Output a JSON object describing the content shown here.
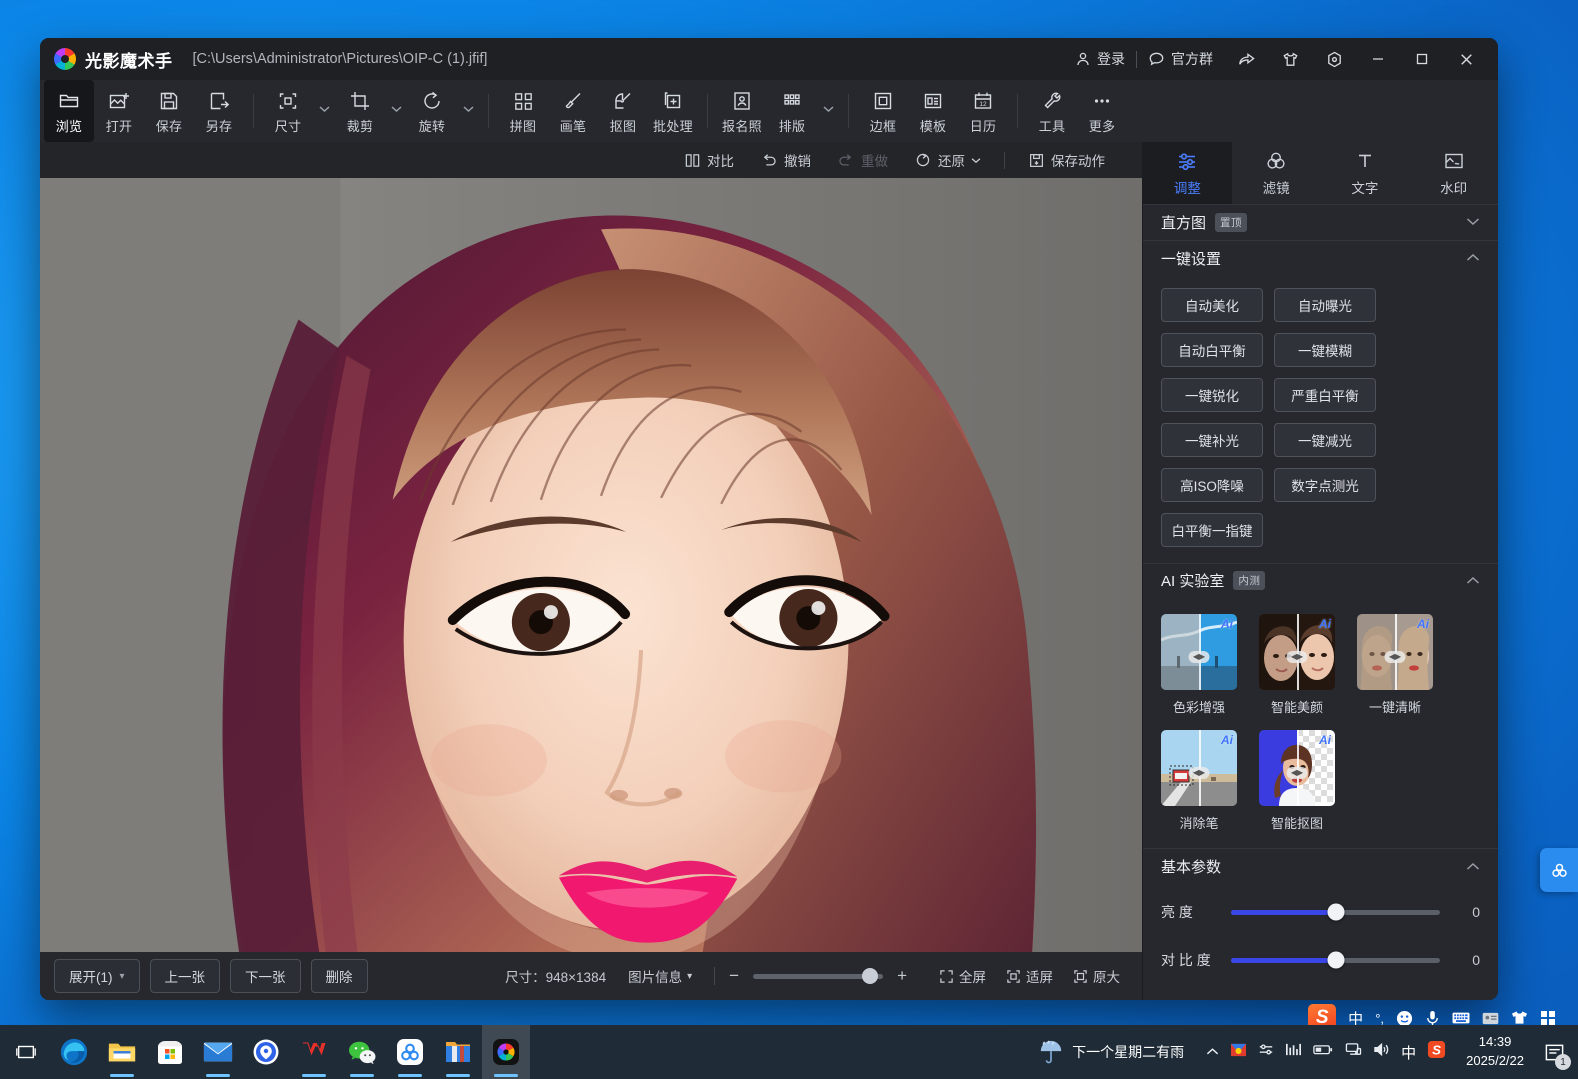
{
  "window": {
    "app_name": "光影魔术手",
    "file_path": "[C:\\Users\\Administrator\\Pictures\\OIP-C (1).jfif]",
    "titlebar_actions": [
      {
        "label": "登录",
        "icon": "user-icon"
      },
      {
        "label": "官方群",
        "icon": "chat-bubble-icon"
      }
    ],
    "titlebar_icons": [
      {
        "name": "share-icon"
      },
      {
        "name": "shirt-icon"
      },
      {
        "name": "settings-hex-icon"
      }
    ],
    "window_controls": [
      {
        "name": "minimize",
        "glyph": "─"
      },
      {
        "name": "maximize",
        "glyph": "☐"
      },
      {
        "name": "close",
        "glyph": "✕"
      }
    ]
  },
  "toolbar": {
    "groups": [
      {
        "items": [
          {
            "label": "浏览",
            "icon": "folder-icon",
            "active": true,
            "caret": false
          },
          {
            "label": "打开",
            "icon": "image-plus-icon",
            "active": false,
            "caret": false
          },
          {
            "label": "保存",
            "icon": "save-icon",
            "active": false,
            "caret": false
          },
          {
            "label": "另存",
            "icon": "save-as-icon",
            "active": false,
            "caret": false
          }
        ]
      },
      {
        "items": [
          {
            "label": "尺寸",
            "icon": "resize-icon",
            "active": false,
            "caret": true
          },
          {
            "label": "裁剪",
            "icon": "crop-icon",
            "active": false,
            "caret": true
          },
          {
            "label": "旋转",
            "icon": "rotate-icon",
            "active": false,
            "caret": true
          }
        ]
      },
      {
        "items": [
          {
            "label": "拼图",
            "icon": "grid-squares-icon",
            "active": false,
            "caret": false
          },
          {
            "label": "画笔",
            "icon": "brush-icon",
            "active": false,
            "caret": false
          },
          {
            "label": "抠图",
            "icon": "cutout-icon",
            "active": false,
            "caret": false
          },
          {
            "label": "批处理",
            "icon": "batch-icon",
            "active": false,
            "caret": false
          }
        ]
      },
      {
        "items": [
          {
            "label": "报名照",
            "icon": "id-photo-icon",
            "active": false,
            "caret": false
          },
          {
            "label": "排版",
            "icon": "layout-dots-icon",
            "active": false,
            "caret": true
          }
        ]
      },
      {
        "items": [
          {
            "label": "边框",
            "icon": "frame-icon",
            "active": false,
            "caret": false
          },
          {
            "label": "模板",
            "icon": "template-icon",
            "active": false,
            "caret": false
          },
          {
            "label": "日历",
            "icon": "calendar-icon",
            "active": false,
            "caret": false
          }
        ]
      },
      {
        "items": [
          {
            "label": "工具",
            "icon": "wrench-icon",
            "active": false,
            "caret": false
          },
          {
            "label": "更多",
            "icon": "ellipsis-icon",
            "active": false,
            "caret": false
          }
        ]
      }
    ]
  },
  "subbar": {
    "items": [
      {
        "label": "对比",
        "icon": "compare-icon",
        "disabled": false,
        "caret": false
      },
      {
        "label": "撤销",
        "icon": "undo-icon",
        "disabled": false,
        "caret": false
      },
      {
        "label": "重做",
        "icon": "redo-icon",
        "disabled": true,
        "caret": false
      },
      {
        "label": "还原",
        "icon": "reset-icon",
        "disabled": false,
        "caret": true
      }
    ],
    "save_action": {
      "label": "保存动作",
      "icon": "save-action-icon"
    }
  },
  "statusbar": {
    "expand": {
      "label": "展开(1)",
      "caret": "▾"
    },
    "prev": "上一张",
    "next": "下一张",
    "delete": "删除",
    "size_text": "尺寸：948×1384",
    "image_info": "图片信息",
    "image_info_caret": "▾",
    "zoom_minus": "−",
    "zoom_plus": "+",
    "zoom_percent": 90,
    "fullscreen": "全屏",
    "fit_screen": "适屏",
    "original_size": "原大"
  },
  "right_panel": {
    "tabs": [
      {
        "label": "调整",
        "icon": "sliders-icon",
        "active": true
      },
      {
        "label": "滤镜",
        "icon": "filter-rings-icon",
        "active": false
      },
      {
        "label": "文字",
        "icon": "text-t-icon",
        "active": false
      },
      {
        "label": "水印",
        "icon": "watermark-icon",
        "active": false
      }
    ],
    "histogram": {
      "title": "直方图",
      "badge": "置顶",
      "collapsed": true,
      "chevron": "⌄"
    },
    "one_click": {
      "title": "一键设置",
      "collapsed": false,
      "buttons": [
        "自动美化",
        "自动曝光",
        "自动白平衡",
        "一键模糊",
        "一键锐化",
        "严重白平衡",
        "一键补光",
        "一键减光",
        "高ISO降噪",
        "数字点测光",
        "白平衡一指键"
      ]
    },
    "ai_lab": {
      "title": "AI 实验室",
      "badge": "内测",
      "collapsed": false,
      "items": [
        {
          "label": "色彩增强",
          "ai_tag": "Ai",
          "thumb": "sky-landscape"
        },
        {
          "label": "智能美颜",
          "ai_tag": "Ai",
          "thumb": "portrait-beauty"
        },
        {
          "label": "一键清晰",
          "ai_tag": "Ai",
          "thumb": "portrait-sharpen"
        },
        {
          "label": "消除笔",
          "ai_tag": "Ai",
          "thumb": "road-truck"
        },
        {
          "label": "智能抠图",
          "ai_tag": "Ai",
          "thumb": "portrait-cutout"
        }
      ]
    },
    "basic_params": {
      "title": "基本参数",
      "collapsed": false,
      "sliders": [
        {
          "label": "亮 度",
          "value": 0,
          "position": 50
        },
        {
          "label": "对 比 度",
          "value": 0,
          "position": 50
        }
      ]
    }
  },
  "side_dock": {
    "icon": "cloud-trio-icon"
  },
  "ime_bar": {
    "logo": "S",
    "items": [
      {
        "name": "mode-chinese",
        "glyph": "中"
      },
      {
        "name": "punctuation",
        "glyph": "°,"
      },
      {
        "name": "emoji-icon",
        "glyph": "☺"
      },
      {
        "name": "mic-icon",
        "glyph": "Ἲ4"
      },
      {
        "name": "keyboard-icon",
        "glyph": "⌨"
      },
      {
        "name": "card-icon",
        "glyph": "▤"
      },
      {
        "name": "shirt-icon",
        "glyph": "ὅ5"
      },
      {
        "name": "grid-icon",
        "glyph": "░"
      }
    ]
  },
  "taskbar": {
    "apps": [
      {
        "name": "task-view",
        "label": "任务视图"
      },
      {
        "name": "edge",
        "label": "Microsoft Edge"
      },
      {
        "name": "file-explorer",
        "label": "文件资源管理器"
      },
      {
        "name": "microsoft-store",
        "label": "Microsoft Store"
      },
      {
        "name": "mail",
        "label": "邮件"
      },
      {
        "name": "browser-blue",
        "label": "浏览器"
      },
      {
        "name": "wps-office",
        "label": "WPS Office"
      },
      {
        "name": "wechat",
        "label": "微信"
      },
      {
        "name": "cloud-app",
        "label": "云盘"
      },
      {
        "name": "folder-app",
        "label": "应用"
      },
      {
        "name": "guangying-app",
        "label": "光影魔术手",
        "active": true
      }
    ],
    "weather": "下一个星期二有雨",
    "tray_icons": [
      {
        "name": "tray-expand",
        "glyph": "∧"
      },
      {
        "name": "tray-video-app"
      },
      {
        "name": "tray-settings"
      },
      {
        "name": "tray-equalizer"
      },
      {
        "name": "tray-battery"
      },
      {
        "name": "tray-network"
      },
      {
        "name": "tray-volume"
      },
      {
        "name": "tray-ime-chinese",
        "glyph": "中"
      },
      {
        "name": "tray-sogou"
      }
    ],
    "time": "14:39",
    "date": "2025/2/22",
    "notification_count": "1"
  }
}
